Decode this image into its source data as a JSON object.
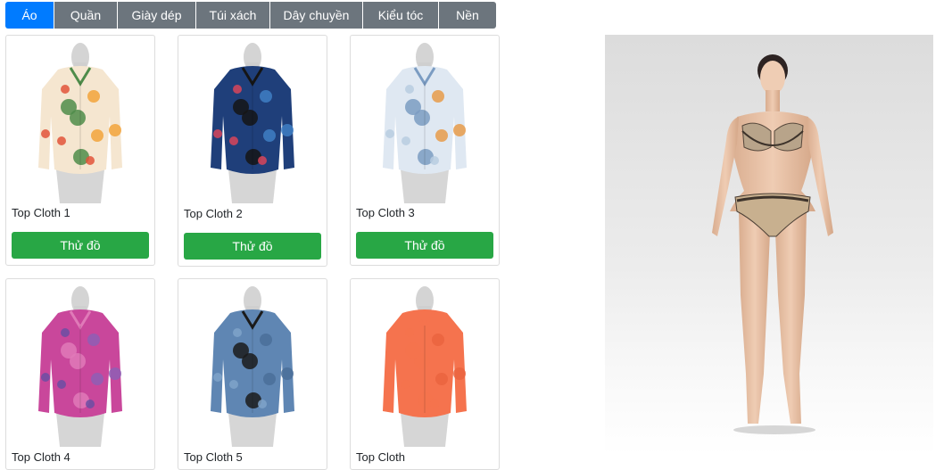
{
  "tabs": [
    {
      "label": "Áo",
      "active": true
    },
    {
      "label": "Quần",
      "active": false
    },
    {
      "label": "Giày dép",
      "active": false
    },
    {
      "label": "Túi xách",
      "active": false
    },
    {
      "label": "Dây chuyền",
      "active": false
    },
    {
      "label": "Kiểu tóc",
      "active": false
    },
    {
      "label": "Nền",
      "active": false
    }
  ],
  "products": [
    {
      "name": "Top Cloth 1",
      "button": "Thử đồ",
      "palette": [
        "#f5e6d0",
        "#e2533a",
        "#f2a33b",
        "#4f8c4a"
      ]
    },
    {
      "name": "Top Cloth 2",
      "button": "Thử đồ",
      "palette": [
        "#1f3f7a",
        "#d8455a",
        "#3f7fc4",
        "#151515"
      ]
    },
    {
      "name": "Top Cloth 3",
      "button": "Thử đồ",
      "palette": [
        "#dfe8f2",
        "#b8cce0",
        "#e79b4a",
        "#7b9cc2"
      ]
    },
    {
      "name": "Top Cloth 4",
      "button": "",
      "palette": [
        "#c9479b",
        "#6b4fa3",
        "#8e5fb5",
        "#e07ab8"
      ]
    },
    {
      "name": "Top Cloth 5",
      "button": "",
      "palette": [
        "#5f86b3",
        "#7fa3c9",
        "#4a6f99",
        "#1b1b1b"
      ]
    },
    {
      "name": "Top Cloth",
      "button": "",
      "palette": [
        "#f5734e",
        "#f5734e",
        "#ea6440",
        "#f5734e"
      ]
    }
  ],
  "colors": {
    "tab_active": "#007bff",
    "tab_inactive": "#6c757d",
    "try_button": "#28a745",
    "preview_bg": "#e4e4e4"
  }
}
